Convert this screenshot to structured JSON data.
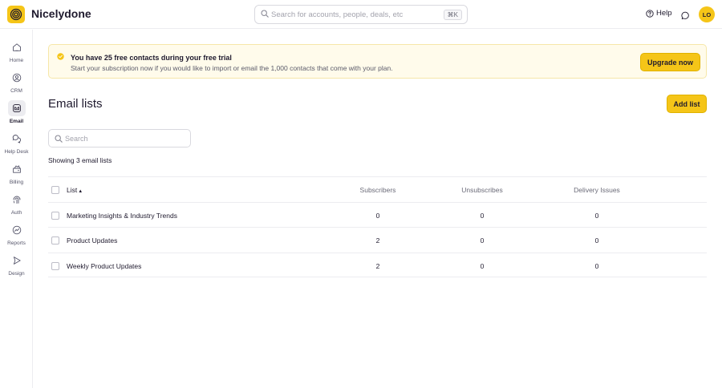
{
  "app": {
    "name": "Nicelydone"
  },
  "header": {
    "search_placeholder": "Search for accounts, people, deals, etc",
    "shortcut": "⌘K",
    "help_label": "Help",
    "avatar_initials": "LO"
  },
  "sidebar": {
    "items": [
      {
        "label": "Home",
        "icon": "home-icon"
      },
      {
        "label": "CRM",
        "icon": "crm-icon"
      },
      {
        "label": "Email",
        "icon": "email-icon",
        "active": true
      },
      {
        "label": "Help Desk",
        "icon": "help-desk-icon"
      },
      {
        "label": "Billing",
        "icon": "billing-icon"
      },
      {
        "label": "Auth",
        "icon": "auth-icon"
      },
      {
        "label": "Reports",
        "icon": "reports-icon"
      },
      {
        "label": "Design",
        "icon": "design-icon"
      }
    ]
  },
  "banner": {
    "title": "You have 25 free contacts during your free trial",
    "text": "Start your subscription now if you would like to import or email the 1,000 contacts that come with your plan.",
    "button_label": "Upgrade now"
  },
  "page": {
    "title": "Email lists",
    "add_button_label": "Add list",
    "search_placeholder": "Search",
    "showing_text": "Showing 3 email lists"
  },
  "table": {
    "columns": {
      "list": "List",
      "subscribers": "Subscribers",
      "unsubscribes": "Unsubscribes",
      "delivery": "Delivery Issues"
    },
    "sort_indicator": "▲",
    "rows": [
      {
        "name": "Marketing Insights & Industry Trends",
        "subscribers": "0",
        "unsubscribes": "0",
        "delivery": "0"
      },
      {
        "name": "Product Updates",
        "subscribers": "2",
        "unsubscribes": "0",
        "delivery": "0"
      },
      {
        "name": "Weekly Product Updates",
        "subscribers": "2",
        "unsubscribes": "0",
        "delivery": "0"
      }
    ]
  },
  "colors": {
    "accent": "#f5c518",
    "banner_bg": "#fffbeb",
    "text": "#1f1a2e"
  }
}
